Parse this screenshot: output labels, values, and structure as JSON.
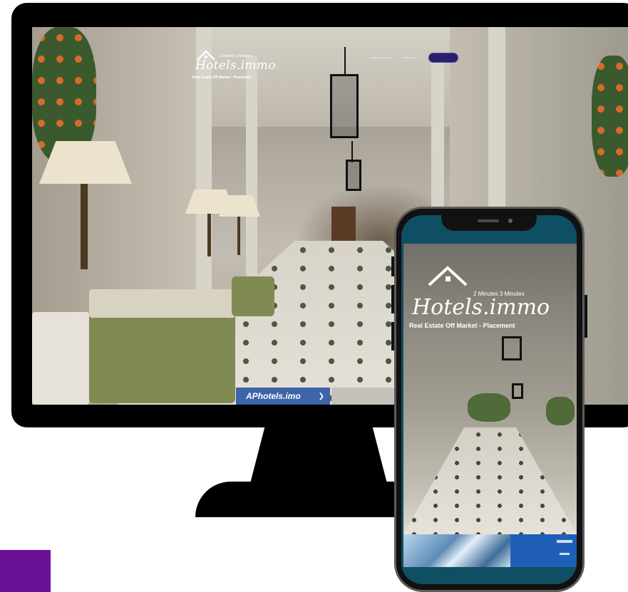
{
  "site": {
    "logo_script": "Hotels.immo",
    "logo_small": "2 Minutes 3 Minutes",
    "logo_sub": "Real Estate Off Market - Placement"
  },
  "nav": {
    "links": [
      "",
      ""
    ],
    "cta": ""
  },
  "banner": {
    "text": "APhotels.imo",
    "arrow": "❯"
  },
  "colors": {
    "accent_purple": "#6b1196",
    "phone_screen": "#0f4f63",
    "banner_blue": "#3e64a9"
  }
}
